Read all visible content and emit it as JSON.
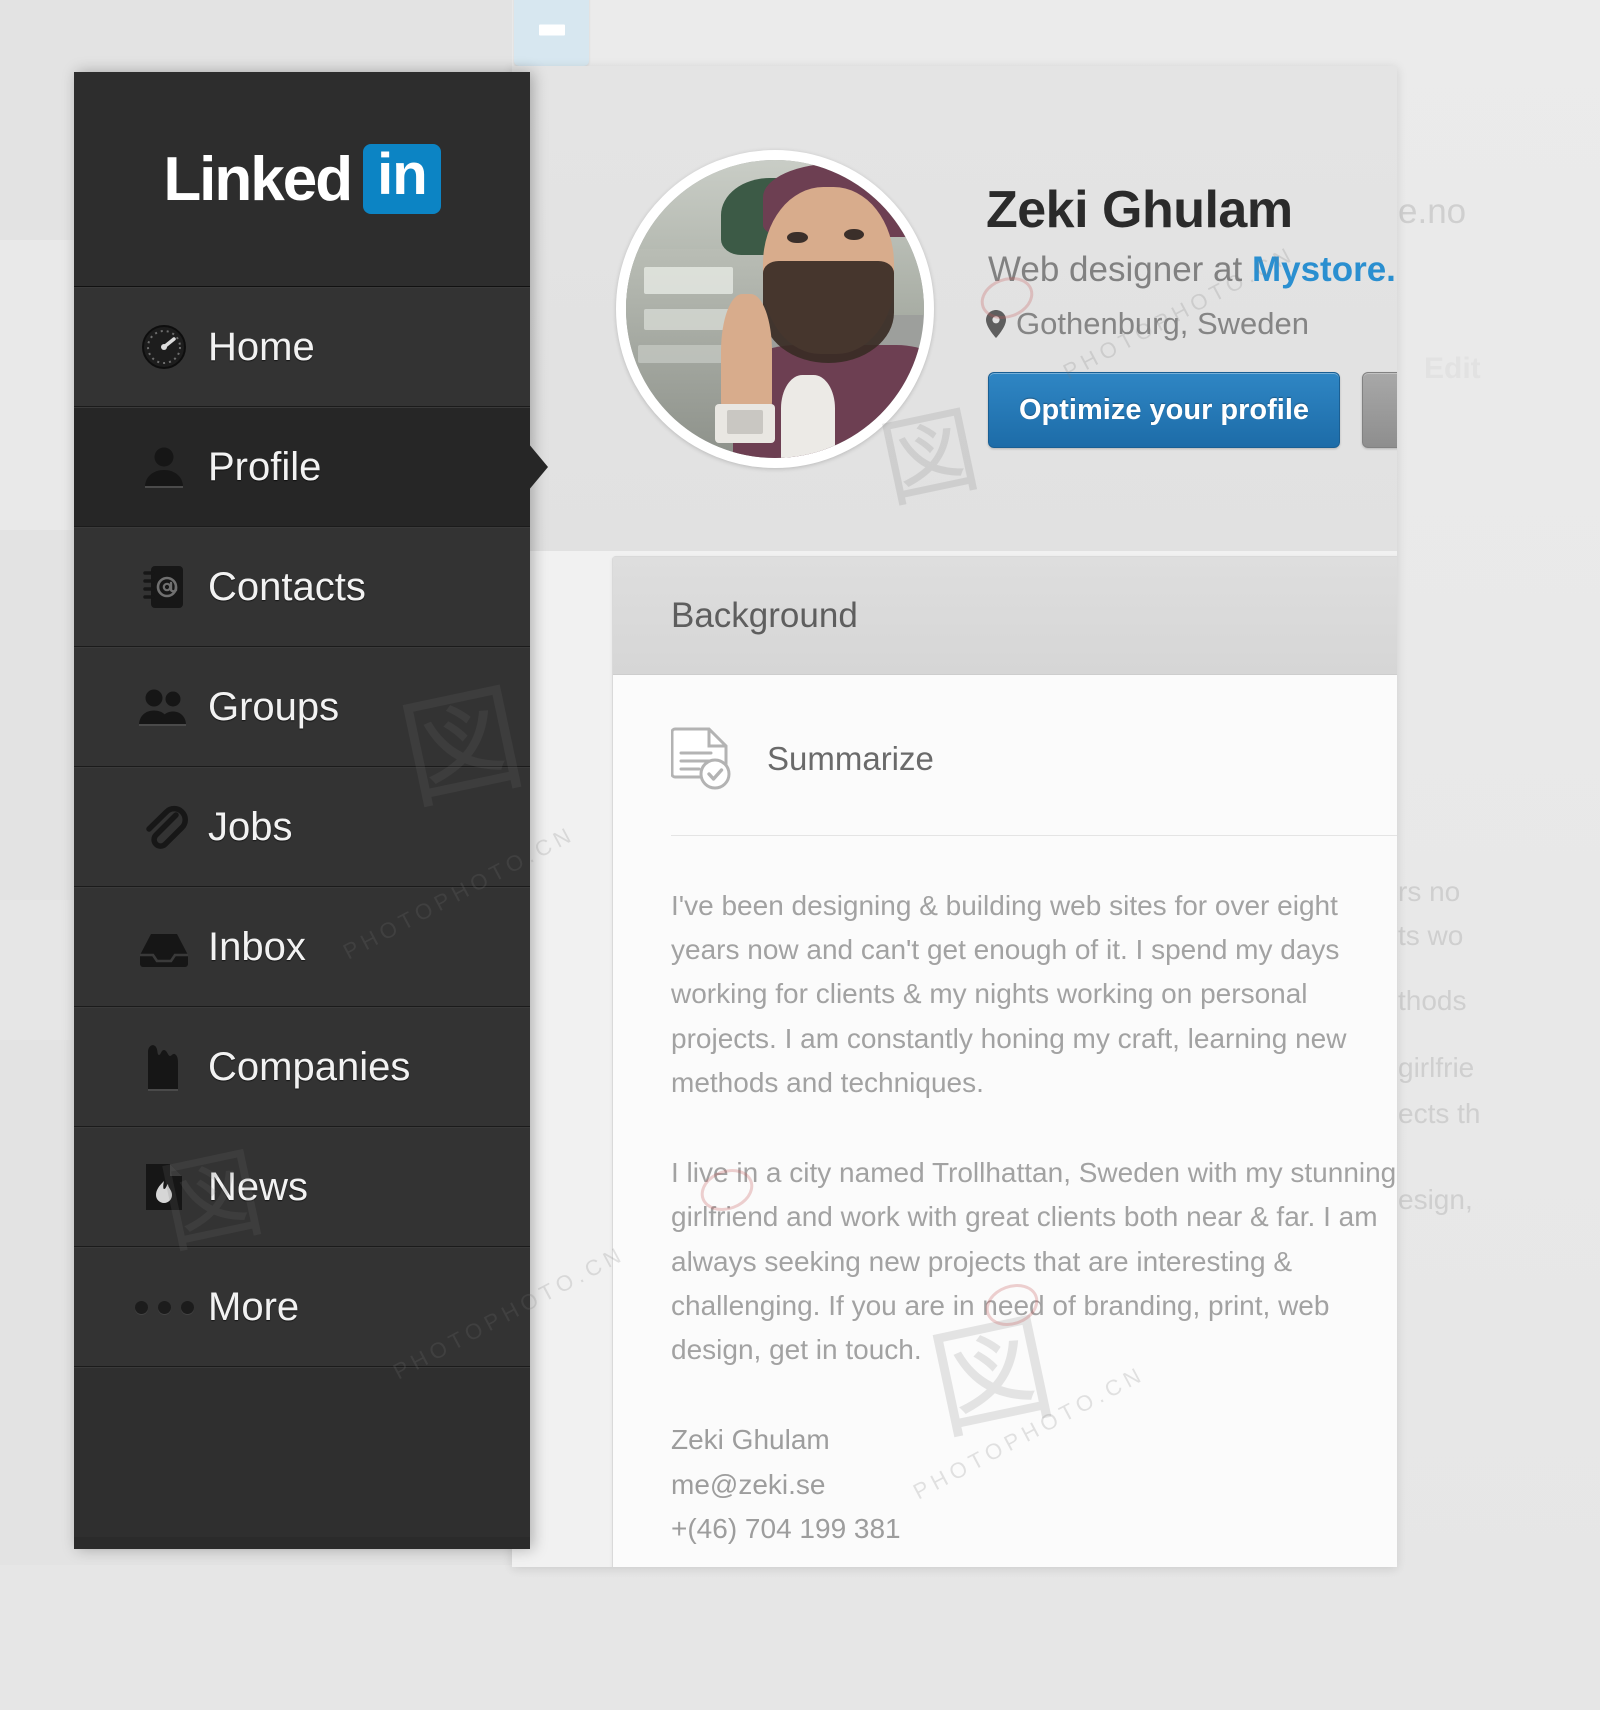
{
  "brand": {
    "logo_word": "Linked",
    "logo_badge": "in",
    "accent_blue": "#0c84c4",
    "link_blue": "#2a8fd0",
    "sidebar_bg": "#2b2b2b"
  },
  "chips": {
    "light_chip_icon": "minimize-icon",
    "blue_chip_icon": "minimize-icon"
  },
  "sidebar": {
    "items": [
      {
        "label": "Home",
        "icon": "speedometer-icon",
        "active": false
      },
      {
        "label": "Profile",
        "icon": "person-icon",
        "active": true
      },
      {
        "label": "Contacts",
        "icon": "address-book-icon",
        "active": false
      },
      {
        "label": "Groups",
        "icon": "people-icon",
        "active": false
      },
      {
        "label": "Jobs",
        "icon": "paperclip-icon",
        "active": false
      },
      {
        "label": "Inbox",
        "icon": "inbox-icon",
        "active": false
      },
      {
        "label": "Companies",
        "icon": "building-icon",
        "active": false
      },
      {
        "label": "News",
        "icon": "news-flame-icon",
        "active": false
      },
      {
        "label": "More",
        "icon": "ellipsis-icon",
        "active": false
      }
    ]
  },
  "profile": {
    "avatar_alt": "profile-photo",
    "name": "Zeki Ghulam",
    "title_prefix": "Web designer at ",
    "company": "Mystore.no",
    "location": "Gothenburg, Sweden",
    "location_icon": "map-pin-icon",
    "primary_button": "Optimize your profile",
    "secondary_button": "Edit",
    "ghost_edit": "Edit",
    "ghost_company": "e.no"
  },
  "background_card": {
    "header": "Background",
    "section_icon": "document-check-icon",
    "section_title": "Summarize",
    "paragraphs": [
      "I've been designing & building web sites for over eight years now and can't get enough of it. I spend my days working for clients & my nights working on personal projects. I am constantly honing my craft, learning new methods and techniques.",
      "I live in a city named Trollhattan, Sweden with my stunning girlfriend and work with great clients both near & far. I am always seeking new projects that are interesting & challenging. If you are in need of branding, print, web design, get in touch."
    ],
    "signature": {
      "name": "Zeki Ghulam",
      "email": "me@zeki.se",
      "phone": "+(46) 704 199 381"
    }
  },
  "ghost_text": {
    "line1": "rs no",
    "line2": "ts wo",
    "line3": "thods",
    "line4": "girlfrie",
    "line5": "ects th",
    "line6": "esign,"
  },
  "watermark": {
    "text": "PHOTOPHOTO.CN"
  }
}
